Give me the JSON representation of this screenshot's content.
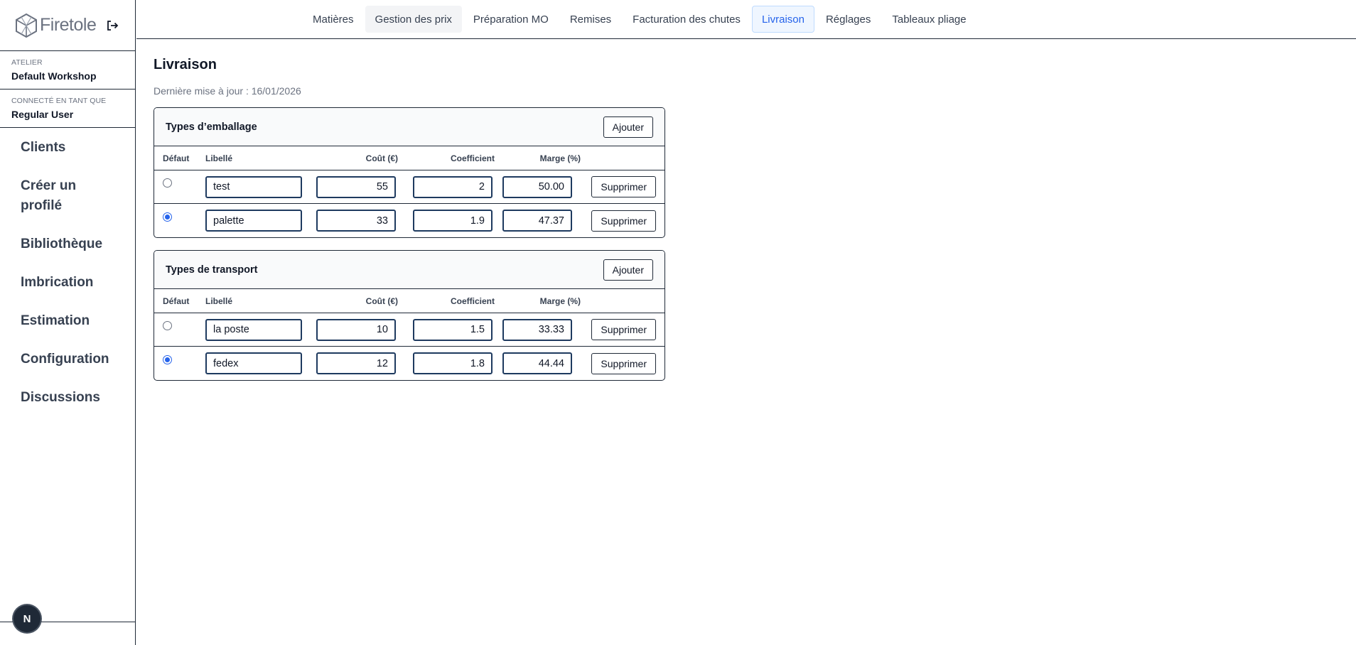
{
  "brand": {
    "name": "Firetole"
  },
  "sidebar": {
    "workshop_label": "ATELIER",
    "workshop_value": "Default Workshop",
    "user_label": "CONNECTÉ EN TANT QUE",
    "user_value": "Regular User",
    "nav": [
      "Clients",
      "Créer un profilé",
      "Bibliothèque",
      "Imbrication",
      "Estimation",
      "Configuration",
      "Discussions"
    ],
    "badge": "N"
  },
  "tabs": [
    "Matières",
    "Gestion des prix",
    "Préparation MO",
    "Remises",
    "Facturation des chutes",
    "Livraison",
    "Réglages",
    "Tableaux pliage"
  ],
  "page": {
    "title": "Livraison",
    "updated": "Dernière mise à jour : 16/01/2026"
  },
  "columns": {
    "default": "Défaut",
    "label": "Libellé",
    "cost": "Coût (€)",
    "coef": "Coefficient",
    "margin": "Marge (%)"
  },
  "add_label": "Ajouter",
  "delete_label": "Supprimer",
  "packaging": {
    "title": "Types d’emballage",
    "rows": [
      {
        "label": "test",
        "cost": "55",
        "coef": "2",
        "margin": "50.00",
        "default": false
      },
      {
        "label": "palette",
        "cost": "33",
        "coef": "1.9",
        "margin": "47.37",
        "default": true
      }
    ]
  },
  "transport": {
    "title": "Types de transport",
    "rows": [
      {
        "label": "la poste",
        "cost": "10",
        "coef": "1.5",
        "margin": "33.33",
        "default": false
      },
      {
        "label": "fedex",
        "cost": "12",
        "coef": "1.8",
        "margin": "44.44",
        "default": true
      }
    ]
  }
}
